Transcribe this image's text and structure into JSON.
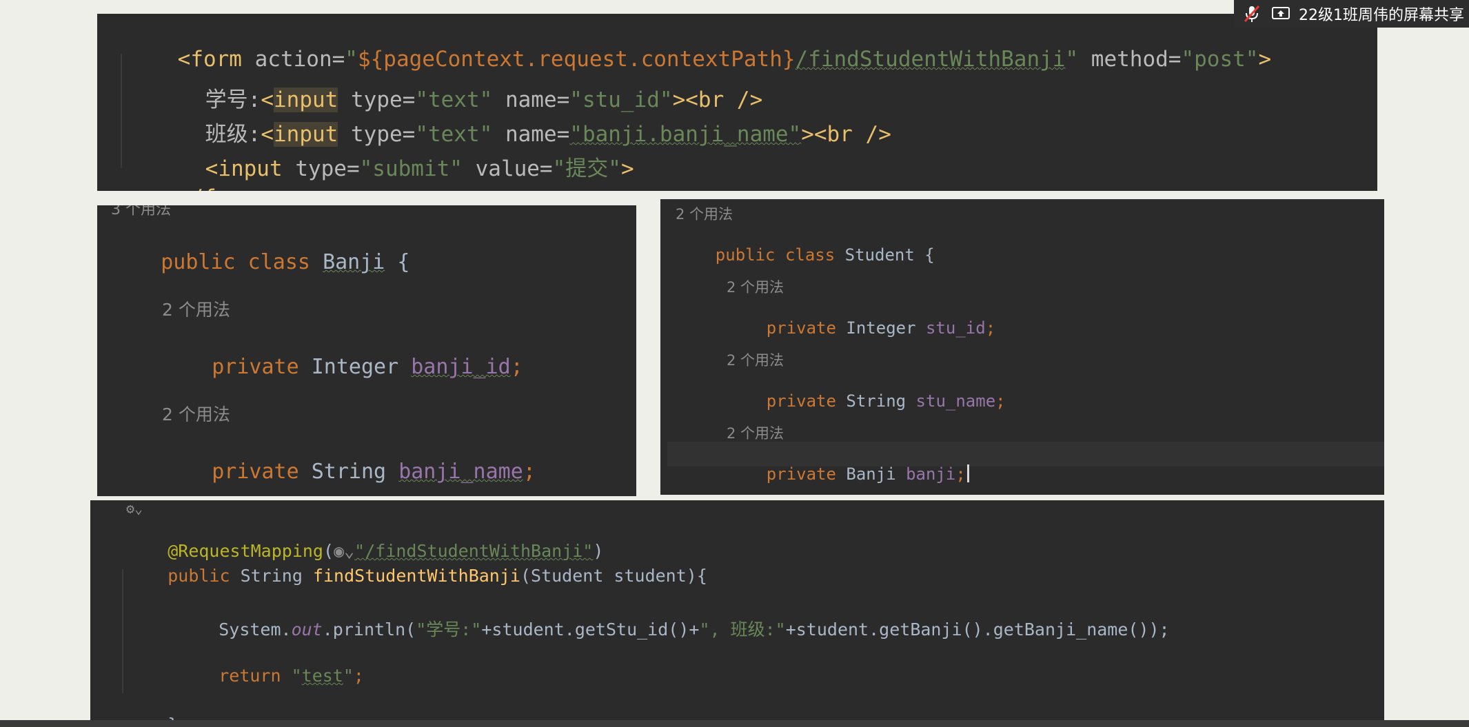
{
  "share_bar": {
    "title": "22级1班周伟的屏幕共享"
  },
  "form_code": {
    "l1_open": "<form ",
    "l1_action": "action=",
    "l1_q1": "\"",
    "l1_el": "${pageContext.request.contextPath}",
    "l1_path": "/findStudentWithBanji",
    "l1_q2": "\" ",
    "l1_method": "method=",
    "l1_post": "\"post\"",
    "l1_close": ">",
    "l2_label": "学号:",
    "l2_lt": "<",
    "l2_input": "input",
    "l2_type": " type=",
    "l2_typev": "\"text\"",
    "l2_name": " name=",
    "l2_namev": "\"stu_id\"",
    "l2_br": "><br />",
    "l3_label": "班级:",
    "l3_lt": "<",
    "l3_input": "input",
    "l3_type": " type=",
    "l3_typev": "\"text\"",
    "l3_name": " name=",
    "l3_namev": "\"banji.banji_name\"",
    "l3_br": "><br />",
    "l4_open": "<input ",
    "l4_type": "type=",
    "l4_typev": "\"submit\"",
    "l4_value": " value=",
    "l4_valuev": "\"提交\"",
    "l4_close": ">",
    "l5": "</form>"
  },
  "banji_code": {
    "top_hint": "3 个用法",
    "decl_kw": "public class ",
    "decl_name": "Banji",
    "decl_brace": " {",
    "hint1": "2 个用法",
    "f1_kw": "private ",
    "f1_type": "Integer ",
    "f1_name": "banji_id",
    "f1_semi": ";",
    "hint2": "2 个用法",
    "f2_kw": "private ",
    "f2_type": "String ",
    "f2_name": "banji_name",
    "f2_semi": ";"
  },
  "student_code": {
    "top_hint": "2 个用法",
    "decl_kw": "public class ",
    "decl_name": "Student",
    "decl_brace": " {",
    "hint1": "2 个用法",
    "f1_kw": "private ",
    "f1_type": "Integer ",
    "f1_name": "stu_id",
    "f1_semi": ";",
    "hint2": "2 个用法",
    "f2_kw": "private ",
    "f2_type": "String ",
    "f2_name": "stu_name",
    "f2_semi": ";",
    "hint3": "2 个用法",
    "f3_kw": "private ",
    "f3_type": "Banji ",
    "f3_name": "banji",
    "f3_semi": ";"
  },
  "controller_code": {
    "annotation": "@RequestMapping",
    "ann_open": "(",
    "ann_path": "\"/findStudentWithBanji\"",
    "ann_close": ")",
    "sig_kw": "public ",
    "sig_type": "String ",
    "sig_name": "findStudentWithBanji",
    "sig_params": "(Student student){",
    "p_sys": "System.",
    "p_out": "out",
    "p_call": ".println(",
    "p_s1": "\"学号:\"",
    "p_mid1": "+student.getStu_id()+",
    "p_s2": "\", 班级:\"",
    "p_mid2": "+student.getBanji().getBanji_name());",
    "r_kw": "return ",
    "r_q1": "\"",
    "r_val": "test",
    "r_q2": "\"",
    "r_semi": ";",
    "close": "}"
  }
}
